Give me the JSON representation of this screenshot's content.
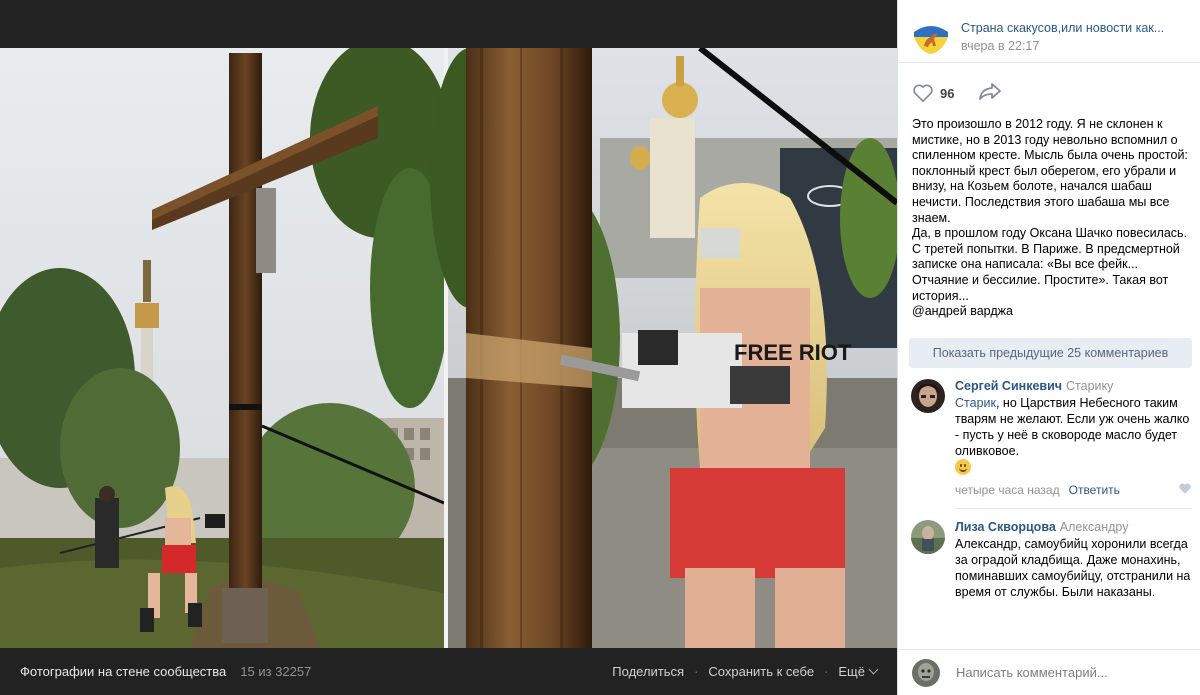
{
  "viewer": {
    "album": "Фотографии на стене сообщества",
    "counter": "15 из 32257",
    "share_label": "Поделиться",
    "save_label": "Сохранить к себе",
    "more_label": "Ещё",
    "photo_text": "FREE RIOT"
  },
  "post": {
    "community_name": "Страна скакусов,или новости как...",
    "time": "вчера в 22:17",
    "like_count": "96",
    "text": [
      "Это произошло в 2012 году. Я не склонен к мистике, но в 2013 году невольно вспомнил о спиленном кресте. Мысль была очень простой: поклонный крест был оберегом, его убрали и внизу, на Козьем болоте, начался шабаш нечисти. Последствия этого шабаша мы все знаем.",
      "Да, в прошлом году Оксана Шачко повесилась. С третей попытки. В Париже. В предсмертной записке она написала: «Вы все фейк... Отчаяние и бессилие. Простите». Такая вот история...",
      "@андрей варджа"
    ]
  },
  "comments": {
    "show_previous": "Показать предыдущие 25 комментариев",
    "items": [
      {
        "author": "Сергей Синкевич",
        "reply_to": "Старику",
        "addressee": "Старик",
        "text": ", но Царствия Небесного таким тварям не желают. Если уж очень жалко - пусть у неё в сковороде масло будет оливковое.",
        "time": "четыре часа назад",
        "reply_label": "Ответить"
      },
      {
        "author": "Лиза Скворцова",
        "reply_to": "Александру",
        "addressee": "",
        "text": "Александр, самоубийц хоронили всегда за оградой кладбища. Даже монахинь, поминавших самоубийцу, отстранили на время от службы. Были наказаны.",
        "time": "",
        "reply_label": ""
      }
    ]
  },
  "compose": {
    "placeholder": "Написать комментарий..."
  },
  "colors": {
    "link": "#2a5885",
    "accent_button_bg": "#e8edf3",
    "viewer_bg": "#222222"
  }
}
